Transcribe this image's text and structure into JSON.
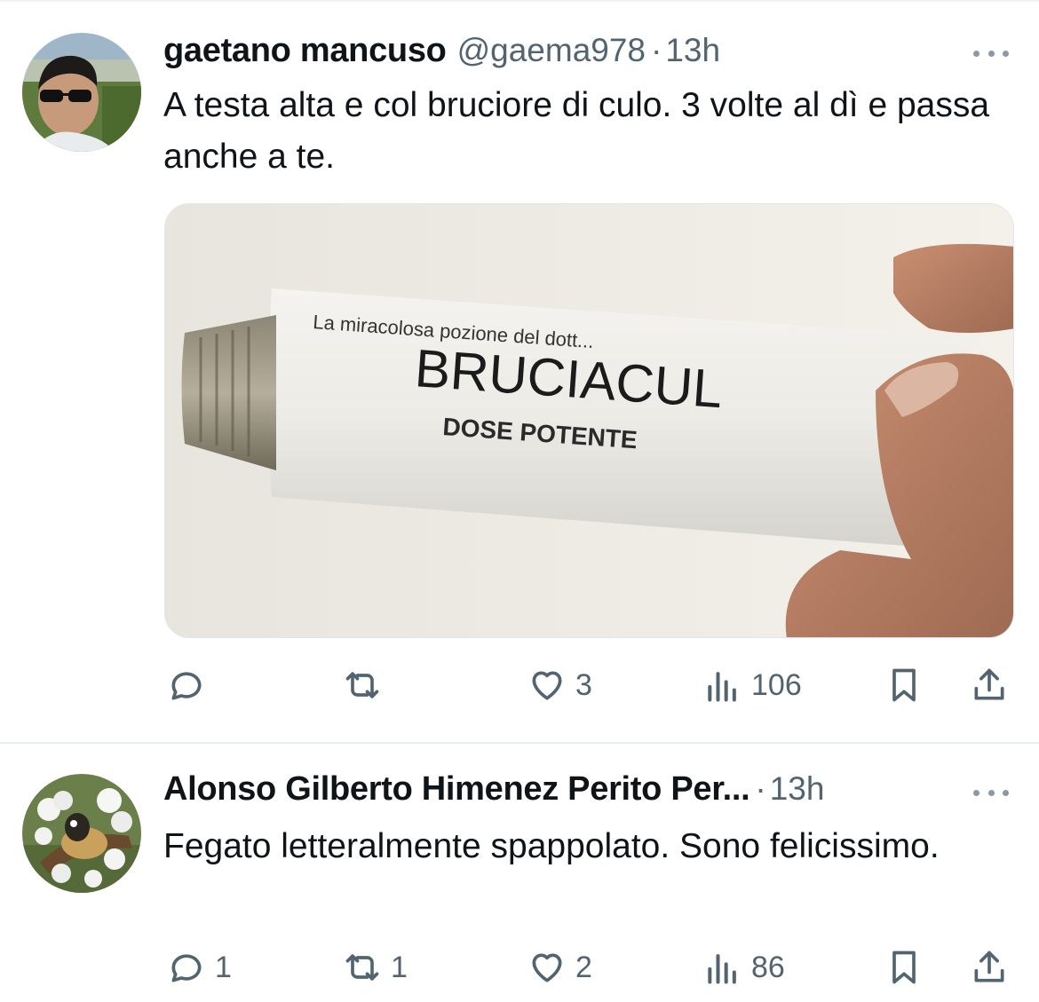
{
  "tweets": [
    {
      "name": "gaetano mancuso",
      "handle": "@gaema978",
      "separator": "·",
      "time": "13h",
      "text": "A testa alta e col bruciore di culo. 3 volte al dì e passa anche a te.",
      "media": {
        "small_text": "La miracolosa pozione del dott...",
        "brand": "BRUCIACUL",
        "subtitle": "DOSE POTENTE"
      },
      "stats": {
        "replies": "",
        "reposts": "",
        "likes": "3",
        "views": "106"
      }
    },
    {
      "name": "Alonso Gilberto Himenez Perito Per...",
      "separator": "·",
      "time": "13h",
      "text": "Fegato letteralmente spappolato. Sono felicissimo.",
      "stats": {
        "replies": "1",
        "reposts": "1",
        "likes": "2",
        "views": "86"
      }
    }
  ],
  "icons": {
    "reply": "reply-icon",
    "repost": "repost-icon",
    "like": "heart-icon",
    "views": "views-icon",
    "bookmark": "bookmark-icon",
    "share": "share-icon",
    "more": "more-icon"
  },
  "colors": {
    "text": "#0f1419",
    "secondary": "#536471",
    "divider": "#e6ecf0"
  }
}
